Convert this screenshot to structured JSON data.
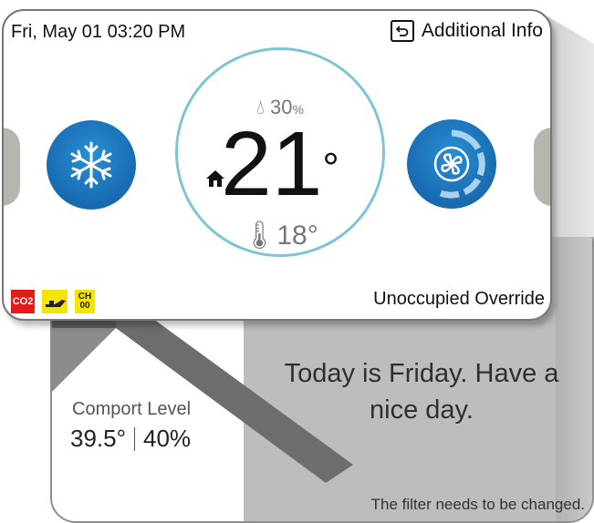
{
  "header": {
    "datetime": "Fri, May 01  03:20 PM",
    "additional_info_label": "Additional Info"
  },
  "dial": {
    "humidity_value": "30",
    "humidity_unit": "%",
    "setpoint": "21",
    "degree": "°",
    "outdoor_temp": "18°"
  },
  "status": {
    "co2_label": "CO2",
    "ch_line1": "CH",
    "ch_line2": "00",
    "override_text": "Unoccupied Override"
  },
  "secondary": {
    "comfort_label": "Comport Level",
    "comfort_temp": "39.5°",
    "comfort_humidity": "40%",
    "greeting": "Today is Friday. Have a nice day.",
    "filter_message": "The filter needs to be changed."
  },
  "colors": {
    "button_blue": "#1a6fb6",
    "ring": "#7fc4d6",
    "co2_red": "#e21b1b",
    "warning_yellow": "#f5e400"
  },
  "icons": {
    "mode": "snowflake-icon",
    "fan": "fan-icon",
    "home": "home-icon",
    "humidity": "water-drop-icon",
    "outdoor": "thermometer-icon",
    "back": "return-arrow-icon"
  }
}
